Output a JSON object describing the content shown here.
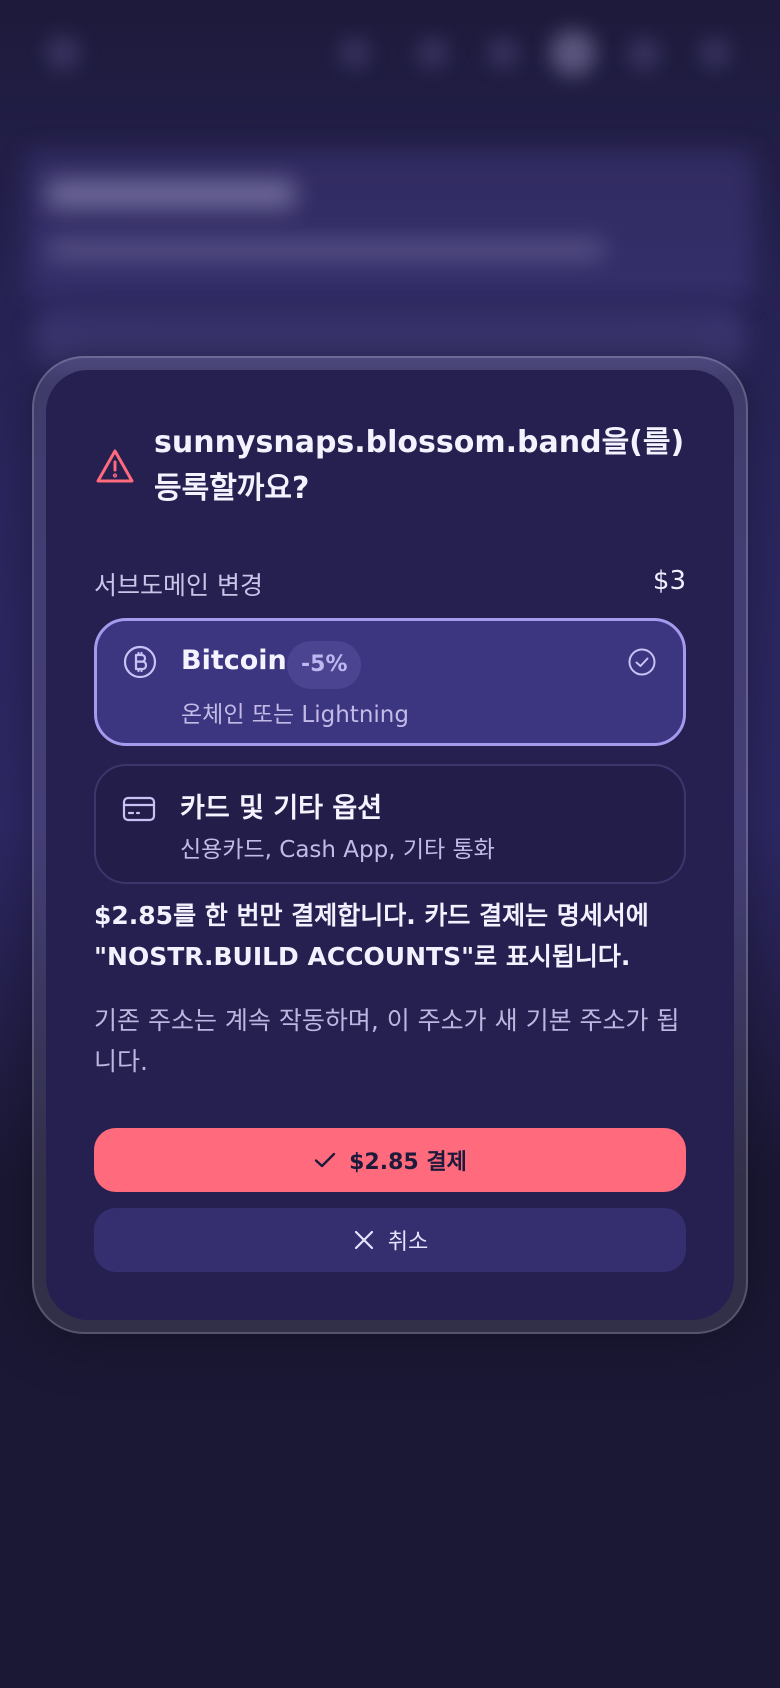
{
  "colors": {
    "background": "#1b1835",
    "modal": "#25204f",
    "selected_option": "#3c3580",
    "selected_border": "#a59bee",
    "warning": "#ff6b7d",
    "primary_button": "#ff6b7d",
    "secondary_button": "#352f70"
  },
  "dialog": {
    "icon": "warning-triangle-icon",
    "title": "sunnysnaps.blossom.band을(를) 등록할까요?",
    "line_item": {
      "label": "서브도메인 변경",
      "price": "$3"
    },
    "payment_options": [
      {
        "icon": "bitcoin-icon",
        "name": "Bitcoin",
        "badge": "-5%",
        "subtitle": "온체인 또는 Lightning",
        "selected": true,
        "selected_icon": "check-circle-icon"
      },
      {
        "icon": "credit-card-icon",
        "name": "카드 및 기타 옵션",
        "subtitle": "신용카드, Cash App, 기타 통화",
        "selected": false
      }
    ],
    "billing_note": "$2.85를 한 번만 결제합니다. 카드 결제는 명세서에 \"NOSTR.BUILD ACCOUNTS\"로 표시됩니다.",
    "info_note": "기존 주소는 계속 작동하며, 이 주소가 새 기본 주소가 됩니다.",
    "pay_button": {
      "icon": "check-icon",
      "label": "$2.85 결제"
    },
    "cancel_button": {
      "icon": "close-icon",
      "label": "취소"
    }
  }
}
